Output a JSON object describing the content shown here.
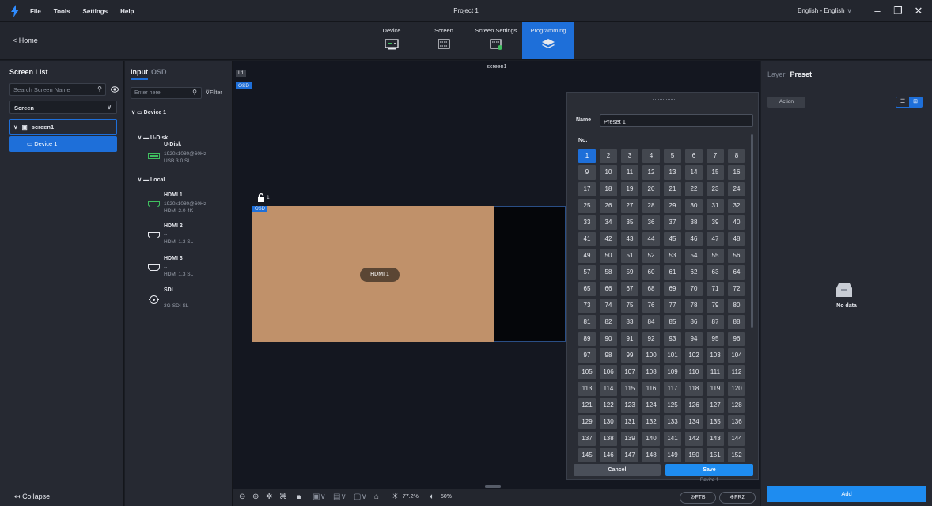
{
  "titlebar": {
    "menu": [
      "File",
      "Tools",
      "Settings",
      "Help"
    ],
    "title": "Project 1",
    "language": "English - English",
    "minimize": "–",
    "restore": "❐",
    "close": "✕"
  },
  "header": {
    "home": "< Home",
    "tabs": [
      {
        "label": "Device",
        "icon": "device-icon"
      },
      {
        "label": "Screen",
        "icon": "screen-icon"
      },
      {
        "label": "Screen Settings",
        "icon": "screen-settings-icon"
      },
      {
        "label": "Programming",
        "icon": "layers-icon",
        "active": true
      }
    ]
  },
  "screen_list": {
    "title": "Screen List",
    "search_placeholder": "Search Screen Name",
    "select_value": "Screen",
    "screen_item": "screen1",
    "device_item": "Device 1",
    "collapse": "Collapse"
  },
  "input_panel": {
    "tab_input": "Input",
    "tab_osd": "OSD",
    "search_placeholder": "Enter here",
    "filter": "Filter",
    "device": "Device 1",
    "udisk_group": "U-Disk",
    "local_group": "Local",
    "sources": [
      {
        "name": "U-Disk",
        "res": "1920x1080@60Hz",
        "spec": "USB 3.0 SL"
      },
      {
        "name": "HDMI 1",
        "res": "1920x1080@60Hz",
        "spec": "HDMI 2.0 4K"
      },
      {
        "name": "HDMI 2",
        "res": "--",
        "spec": "HDMI 1.3 SL"
      },
      {
        "name": "HDMI 3",
        "res": "--",
        "spec": "HDMI 1.3 SL"
      },
      {
        "name": "SDI",
        "res": "--",
        "spec": "3G-SDI SL"
      }
    ]
  },
  "canvas": {
    "screen_name": "screen1",
    "layer_tag": "L1",
    "osd_tag": "OSD",
    "window_osd_tag": "OSD",
    "layer_number": "1",
    "window_source": "HDMI 1"
  },
  "preset_dialog": {
    "name_label": "Name",
    "name_value": "Preset 1",
    "no_label": "No.",
    "selected": 1,
    "count": 152,
    "cancel": "Cancel",
    "save": "Save",
    "device_peek": "Device 1"
  },
  "toolbar": {
    "brightness": "77.2%",
    "volume": "50%",
    "ftb": "FTB",
    "frz": "FRZ"
  },
  "right_panel": {
    "tab_layer": "Layer",
    "tab_preset": "Preset",
    "action": "Action",
    "no_data": "No data",
    "add": "Add"
  },
  "colors": {
    "accent": "#1e6fd9",
    "window_fill": "#c0916a"
  }
}
